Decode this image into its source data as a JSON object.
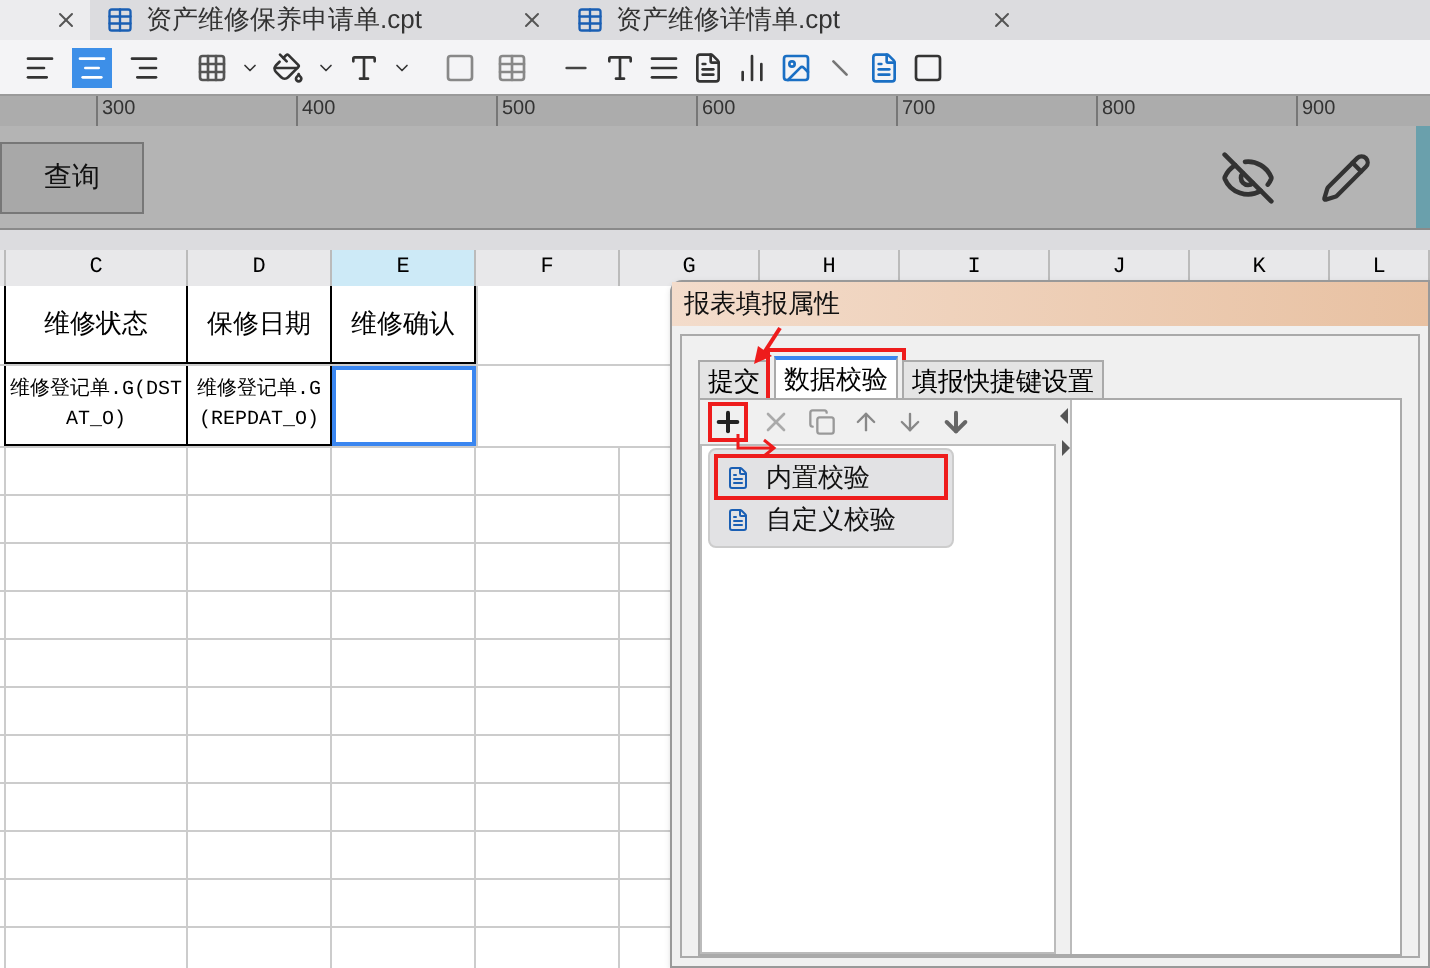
{
  "file_tabs": [
    {
      "title": "资产维修保养申请单.cpt"
    },
    {
      "title": "资产维修详情单.cpt"
    }
  ],
  "toolbar": {
    "align_buttons": [
      {
        "kind": "left",
        "selected": false
      },
      {
        "kind": "center",
        "selected": true
      },
      {
        "kind": "right",
        "selected": false
      }
    ]
  },
  "ruler": [
    "300",
    "400",
    "500",
    "600",
    "700",
    "800",
    "900"
  ],
  "parameter_pane": {
    "query_button": "查询"
  },
  "sheet": {
    "columns": [
      {
        "label": "C",
        "selected": false
      },
      {
        "label": "D",
        "selected": false
      },
      {
        "label": "E",
        "selected": true
      },
      {
        "label": "F",
        "selected": false
      },
      {
        "label": "G",
        "selected": false
      },
      {
        "label": "H",
        "selected": false
      },
      {
        "label": "I",
        "selected": false
      },
      {
        "label": "J",
        "selected": false
      },
      {
        "label": "K",
        "selected": false
      },
      {
        "label": "L",
        "selected": false
      }
    ],
    "rows": [
      {
        "cells": [
          {
            "text": "维修状态",
            "selected": false
          },
          {
            "text": "保修日期",
            "selected": false
          },
          {
            "text": "维修确认",
            "selected": false
          }
        ]
      },
      {
        "cells": [
          {
            "text": "维修登记单.G(DSTAT_O)",
            "selected": false
          },
          {
            "text": "维修登记单.G(REPDAT_O)",
            "selected": false
          },
          {
            "selected": true
          }
        ]
      }
    ]
  },
  "dialog": {
    "title": "报表填报属性",
    "tabs": [
      {
        "label": "提交",
        "selected": false,
        "highlighted": false
      },
      {
        "label": "数据校验",
        "selected": true,
        "highlighted": true
      },
      {
        "label": "填报快捷键设置",
        "selected": false,
        "highlighted": false
      }
    ],
    "add_button": {
      "highlighted": true
    },
    "menu": [
      {
        "label": "内置校验",
        "highlighted": true
      },
      {
        "label": "自定义校验",
        "highlighted": false
      }
    ]
  }
}
